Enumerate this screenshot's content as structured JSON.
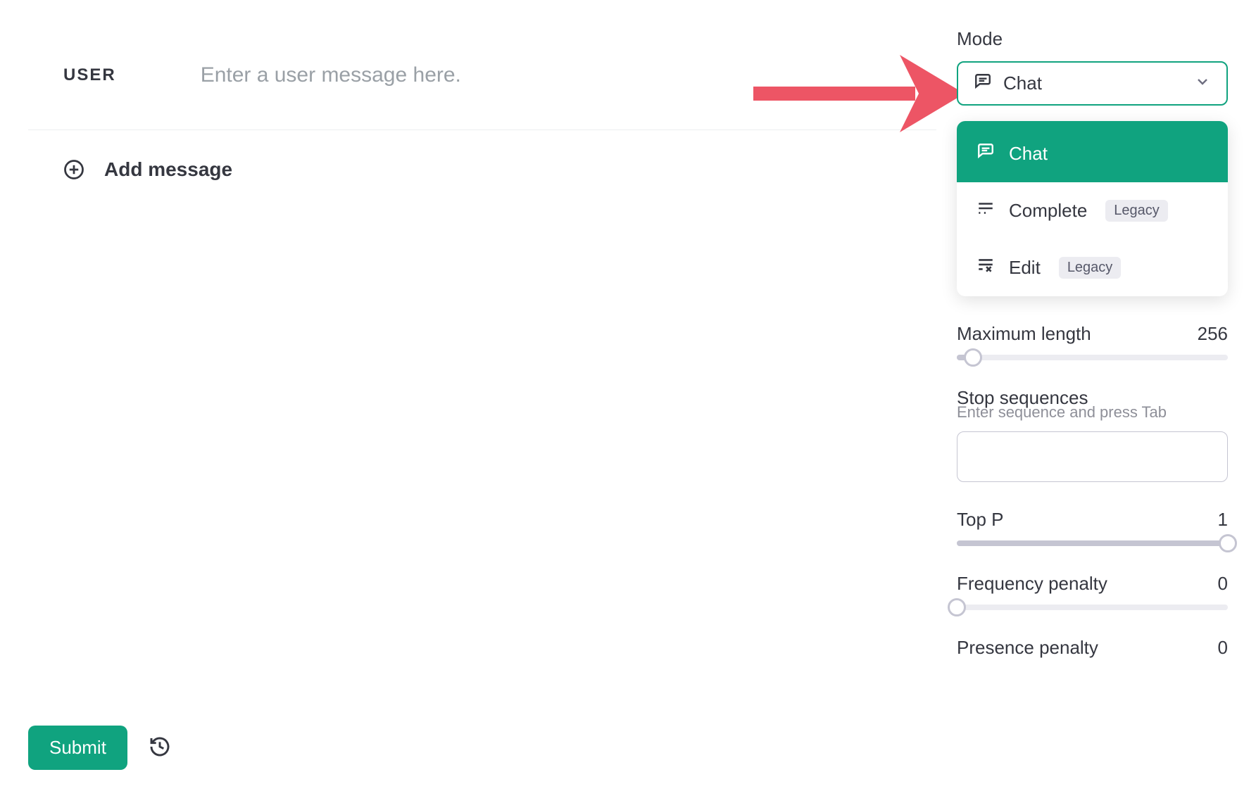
{
  "main": {
    "user_label": "USER",
    "user_placeholder": "Enter a user message here.",
    "add_message_label": "Add message"
  },
  "footer": {
    "submit_label": "Submit"
  },
  "sidebar": {
    "mode_label": "Mode",
    "mode_selected": "Chat",
    "mode_options": [
      {
        "label": "Chat",
        "badge": null
      },
      {
        "label": "Complete",
        "badge": "Legacy"
      },
      {
        "label": "Edit",
        "badge": "Legacy"
      }
    ],
    "max_length_label": "Maximum length",
    "max_length_value": "256",
    "stop_label": "Stop sequences",
    "stop_help": "Enter sequence and press Tab",
    "top_p_label": "Top P",
    "top_p_value": "1",
    "freq_penalty_label": "Frequency penalty",
    "freq_penalty_value": "0",
    "presence_penalty_label": "Presence penalty",
    "presence_penalty_value": "0"
  }
}
